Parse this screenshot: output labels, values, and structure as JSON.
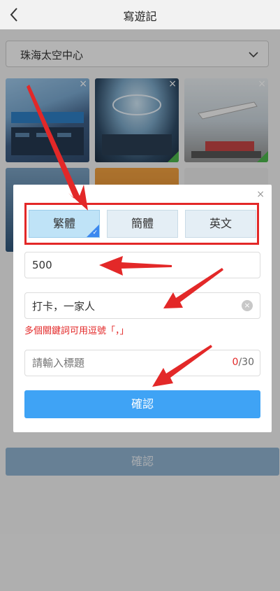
{
  "header": {
    "title": "寫遊記"
  },
  "location": {
    "value": "珠海太空中心"
  },
  "background_submit_label": "確認",
  "modal": {
    "close_symbol": "×",
    "languages": [
      {
        "label": "繁體",
        "selected": true
      },
      {
        "label": "簡體",
        "selected": false
      },
      {
        "label": "英文",
        "selected": false
      }
    ],
    "number_value": "500",
    "keywords_value": "打卡，一家人",
    "keywords_hint": "多個關鍵詞可用逗號「，」",
    "title_placeholder": "請輸入標題",
    "title_counter_current": "0",
    "title_counter_max": "/30",
    "confirm_label": "確認"
  },
  "colors": {
    "accent": "#3fa3f5",
    "annotation_red": "#e32828"
  }
}
